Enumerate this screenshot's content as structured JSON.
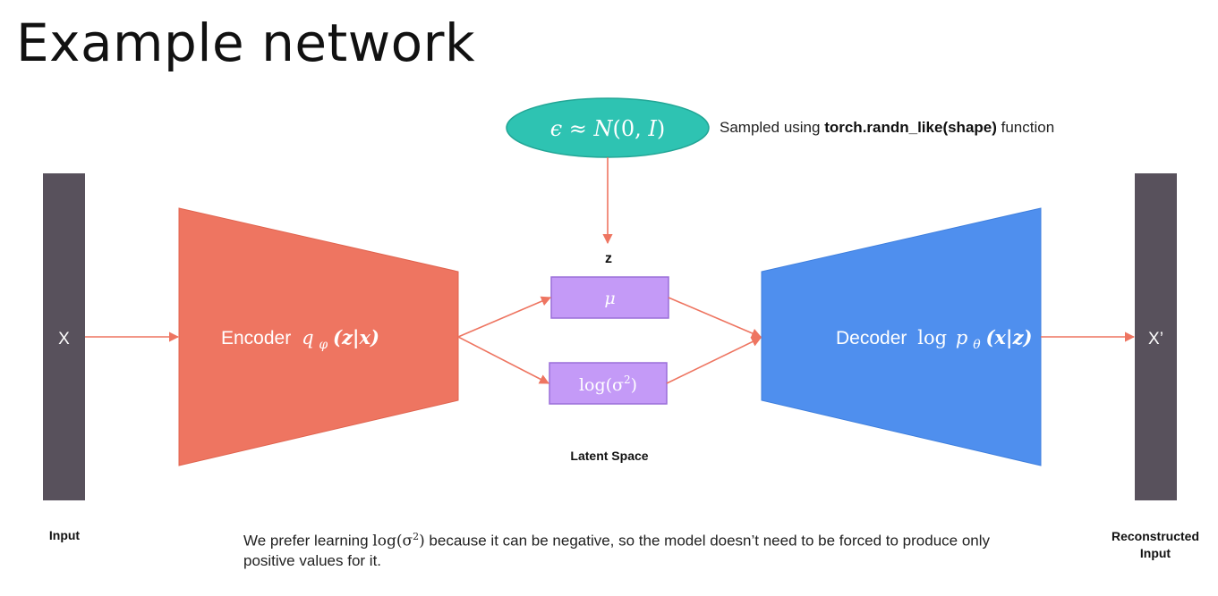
{
  "title": "Example network",
  "nodes": {
    "input_bar_label": "X",
    "output_bar_label": "X’",
    "encoder_text": "Encoder",
    "encoder_math": "q",
    "encoder_math_sub": "φ",
    "encoder_math_args": "(z|x)",
    "decoder_text": "Decoder",
    "decoder_math_log": "log",
    "decoder_math_p": "p",
    "decoder_math_sub": "θ",
    "decoder_math_args": "(x|z)",
    "mu_label": "μ",
    "logvar_label_pre": "log(σ",
    "logvar_label_sup": "2",
    "logvar_label_post": ")",
    "z_label": "z",
    "epsilon_pre": "ϵ ≈ ",
    "epsilon_n": "N",
    "epsilon_args": "(0, ",
    "epsilon_i": "I",
    "epsilon_close": ")"
  },
  "captions": {
    "input": "Input",
    "latent_space": "Latent Space",
    "reconstructed_line1": "Reconstructed",
    "reconstructed_line2": "Input"
  },
  "notes": {
    "sampled_pre": "Sampled using ",
    "sampled_bold": "torch.randn_like(shape)",
    "sampled_post": " function",
    "bottom_pre": "We prefer learning ",
    "bottom_math_pre": "log(σ",
    "bottom_math_sup": "2",
    "bottom_math_post": ")",
    "bottom_post": " because it can be negative, so the model doesn’t need to be forced to produce only positive values for it."
  },
  "colors": {
    "bar": "#58515c",
    "encoder": "#ee7561",
    "decoder": "#4f8fee",
    "latent_box": "#c49af7",
    "latent_box_border": "#9a6ed8",
    "epsilon": "#2ec3b2",
    "arrow": "#ee7561"
  }
}
